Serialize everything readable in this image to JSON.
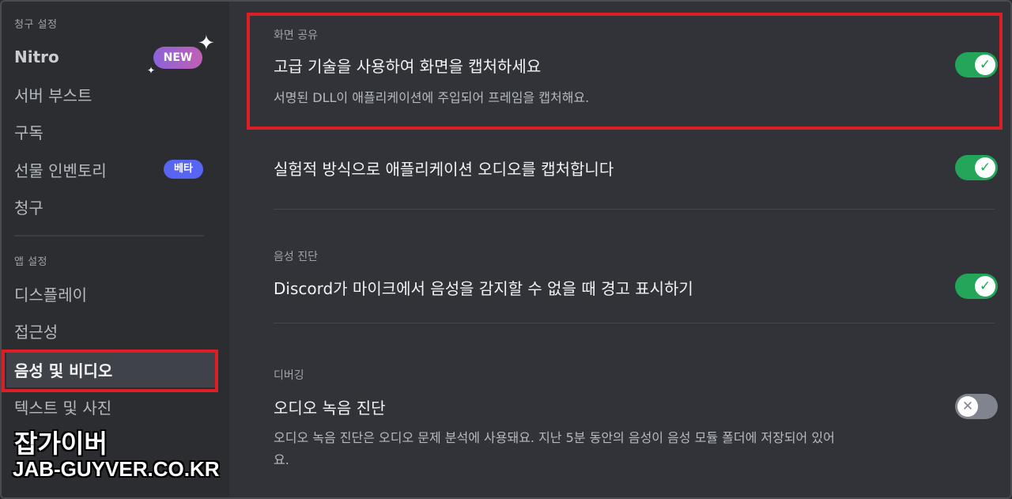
{
  "sidebar": {
    "billing_header": "청구 설정",
    "items": [
      {
        "label": "Nitro"
      },
      {
        "label": "서버 부스트"
      },
      {
        "label": "구독"
      },
      {
        "label": "선물 인벤토리"
      },
      {
        "label": "청구"
      }
    ],
    "new_badge": "NEW",
    "beta_badge": "베타",
    "app_header": "앱 설정",
    "app_items": [
      {
        "label": "디스플레이"
      },
      {
        "label": "접근성"
      },
      {
        "label": "음성 및 비디오"
      },
      {
        "label": "텍스트 및 사진"
      }
    ]
  },
  "watermark": {
    "korean": "잡가이버",
    "url": "JAB-GUYVER.CO.KR"
  },
  "content": {
    "screen_share": {
      "header": "화면 공유",
      "title": "고급 기술을 사용하여 화면을 캡처하세요",
      "desc": "서명된 DLL이 애플리케이션에 주입되어 프레임을 캡처해요.",
      "enabled": true
    },
    "audio_capture": {
      "title": "실험적 방식으로 애플리케이션 오디오를 캡처합니다",
      "enabled": true
    },
    "voice_diag": {
      "header": "음성 진단",
      "title": "Discord가 마이크에서 음성을 감지할 수 없을 때 경고 표시하기",
      "enabled": true
    },
    "debug": {
      "header": "디버깅",
      "title": "오디오 녹음 진단",
      "desc_line1": "오디오 녹음 진단은 오디오 문제 분석에 사용돼요. 지난 5분 동안의 음성이 음성 모듈 폴더에 저장되어 있어",
      "desc_line2": "요.",
      "enabled": false
    }
  },
  "colors": {
    "toggle_on": "#23a55a",
    "toggle_off": "#80848e",
    "highlight": "#dc1f26"
  },
  "icons": {
    "toggle_on": "check-icon",
    "toggle_off": "x-icon",
    "sparkle": "sparkle-icon"
  }
}
